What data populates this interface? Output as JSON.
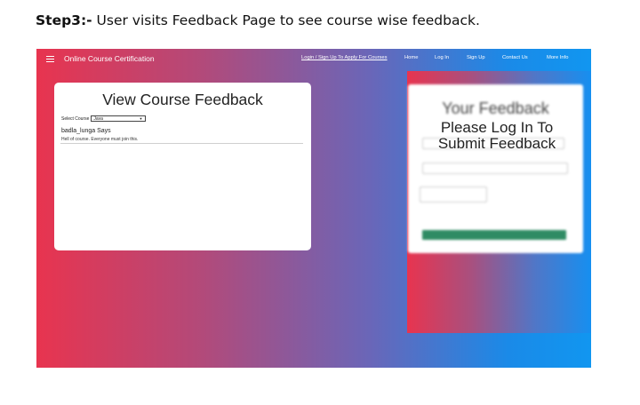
{
  "caption": {
    "step": "Step3:-",
    "text": " User visits Feedback Page to see course wise feedback."
  },
  "app": {
    "brand": "Online Course Certification",
    "nav": {
      "signup_apply": "Login / Sign Up To Apply For Courses",
      "home": "Home",
      "login": "Log In",
      "signup": "Sign Up",
      "contact": "Contact Us",
      "more": "More Info"
    }
  },
  "view_panel": {
    "title": "View Course Feedback",
    "select_label": "Select Course",
    "select_value": "Java",
    "feedback": {
      "author": "badla_lunga Says",
      "comment": "Hell of course. Everyone must join this."
    }
  },
  "feedback_panel": {
    "title": "Your Feedback",
    "login_message": "Please Log In To Submit Feedback"
  },
  "icons": {
    "menu": "hamburger-icon",
    "select": "chevron-down-icon"
  },
  "colors": {
    "gradient_left": "#e8344f",
    "gradient_right": "#1196f0",
    "submit_button": "#2f8b64"
  }
}
